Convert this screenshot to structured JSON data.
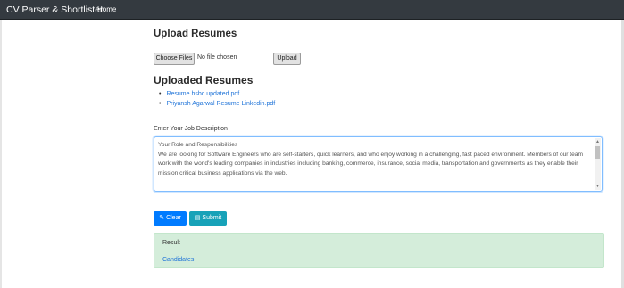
{
  "navbar": {
    "brand": "CV Parser & Shortlister",
    "home_label": "Home"
  },
  "upload": {
    "heading": "Upload Resumes",
    "choose_button": "Choose Files",
    "file_status": "No file chosen",
    "upload_button": "Upload"
  },
  "uploaded": {
    "heading": "Uploaded Resumes",
    "files": [
      "Resume hsbc updated.pdf",
      "Priyansh Agarwal Resume Linkedin.pdf"
    ]
  },
  "job_description": {
    "label": "Enter Your Job Description",
    "value": "Your Role and Responsibilities\nWe are looking for Software Engineers who are self-starters, quick learners, and who enjoy working in a challenging, fast paced environment. Members of our team work with the world's leading companies in industries including banking, commerce, insurance, social media, transportation and governments as they enable their mission critical business applications via the web."
  },
  "actions": {
    "clear_label": "Clear",
    "submit_label": "Submit"
  },
  "result": {
    "title": "Result",
    "link_label": "Candidates"
  },
  "colors": {
    "navbar": "#343a40",
    "primary": "#007bff",
    "info": "#17a2b8",
    "success_bg": "#d4edda",
    "link": "#1e73d8"
  },
  "icons": {
    "clear": "eraser-icon",
    "submit": "file-icon"
  }
}
